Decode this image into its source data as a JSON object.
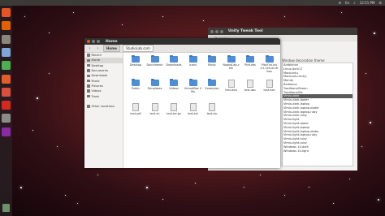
{
  "top_panel": {
    "indicators": [
      "✉",
      "En",
      "♪",
      "12:51 PM",
      "⚙"
    ]
  },
  "launcher": {
    "items": [
      {
        "name": "dash-icon",
        "color": "#e95420"
      },
      {
        "name": "firefox-icon",
        "color": "#e66000"
      },
      {
        "name": "files-icon",
        "color": "#8c8579"
      },
      {
        "name": "document-icon",
        "color": "#7ea6d8"
      },
      {
        "name": "spreadsheet-icon",
        "color": "#4caf50"
      },
      {
        "name": "presentation-icon",
        "color": "#e35d2a"
      },
      {
        "name": "software-center-icon",
        "color": "#d94f3b"
      },
      {
        "name": "amazon-icon",
        "color": "#d8281c"
      },
      {
        "name": "settings-icon",
        "color": "#8b8b8b"
      },
      {
        "name": "ubuntu-one-icon",
        "color": "#8a2aa6"
      }
    ]
  },
  "tweak_window": {
    "title": "Unity Tweak Tool",
    "overview": "Overview",
    "theme_label": "Window decoration theme",
    "themes": [
      "Ambiance",
      "Linux-dark17",
      "Macbuntu",
      "Macbuntu-entry",
      "Mendy",
      "Radiance",
      "TraditionalGreen",
      "TraditionalOk",
      "Vimix-dark",
      "Vimix-dark-doder",
      "Vimix-dark-laptop",
      "Vimix-dark-laptop-doder",
      "Vimix-dark-laptop-ruby",
      "Vimix-dark-ruby",
      "Vimix-light",
      "Vimix-light-doder",
      "Vimix-light-laptop",
      "Vimix-light-laptop-doder",
      "Vimix-light-laptop-ruby",
      "Vimix-light-ruby",
      "Vimix-light-ruby",
      "Windows 10-dark",
      "Windows 10-light"
    ],
    "selected_index": 8
  },
  "files_window": {
    "title": "Home",
    "breadcrumb": [
      "Home",
      "StudioLab.com"
    ],
    "sidebar": [
      {
        "label": "Recent",
        "icon": "recent-icon"
      },
      {
        "label": "Home",
        "icon": "home-icon"
      },
      {
        "label": "Desktop",
        "icon": "desktop-icon"
      },
      {
        "label": "Documents",
        "icon": "documents-icon"
      },
      {
        "label": "Downloads",
        "icon": "downloads-icon"
      },
      {
        "label": "Music",
        "icon": "music-icon"
      },
      {
        "label": "Pictures",
        "icon": "pictures-icon"
      },
      {
        "label": "Videos",
        "icon": "videos-icon"
      },
      {
        "label": "Trash",
        "icon": "trash-icon"
      },
      {
        "label": "",
        "icon": ""
      },
      {
        "label": "Other Locations",
        "icon": "other-locations-icon"
      }
    ],
    "files": [
      {
        "name": "Desktop",
        "type": "folder"
      },
      {
        "name": "Documents",
        "type": "folder"
      },
      {
        "name": "Downloads",
        "type": "folder"
      },
      {
        "name": "icons",
        "type": "folder"
      },
      {
        "name": "Music",
        "type": "folder"
      },
      {
        "name": "NoobsLab.com",
        "type": "folder"
      },
      {
        "name": "Pictures",
        "type": "folder"
      },
      {
        "name": "PlayOnLinux's virtual drives",
        "type": "folder"
      },
      {
        "name": "Public",
        "type": "folder"
      },
      {
        "name": "Templates",
        "type": "folder"
      },
      {
        "name": "Videos",
        "type": "folder"
      },
      {
        "name": "VirtualBox VMs",
        "type": "folder"
      },
      {
        "name": "Examples",
        "type": "folder"
      },
      {
        "name": "test.deb",
        "type": "doc"
      },
      {
        "name": "test.doc",
        "type": "doc"
      },
      {
        "name": "test.exe",
        "type": "doc"
      },
      {
        "name": "test.pdf",
        "type": "doc"
      },
      {
        "name": "test.sh",
        "type": "doc"
      },
      {
        "name": "test.tar.gz",
        "type": "doc"
      },
      {
        "name": "test.txt",
        "type": "doc"
      },
      {
        "name": "test.zip",
        "type": "doc"
      }
    ]
  }
}
